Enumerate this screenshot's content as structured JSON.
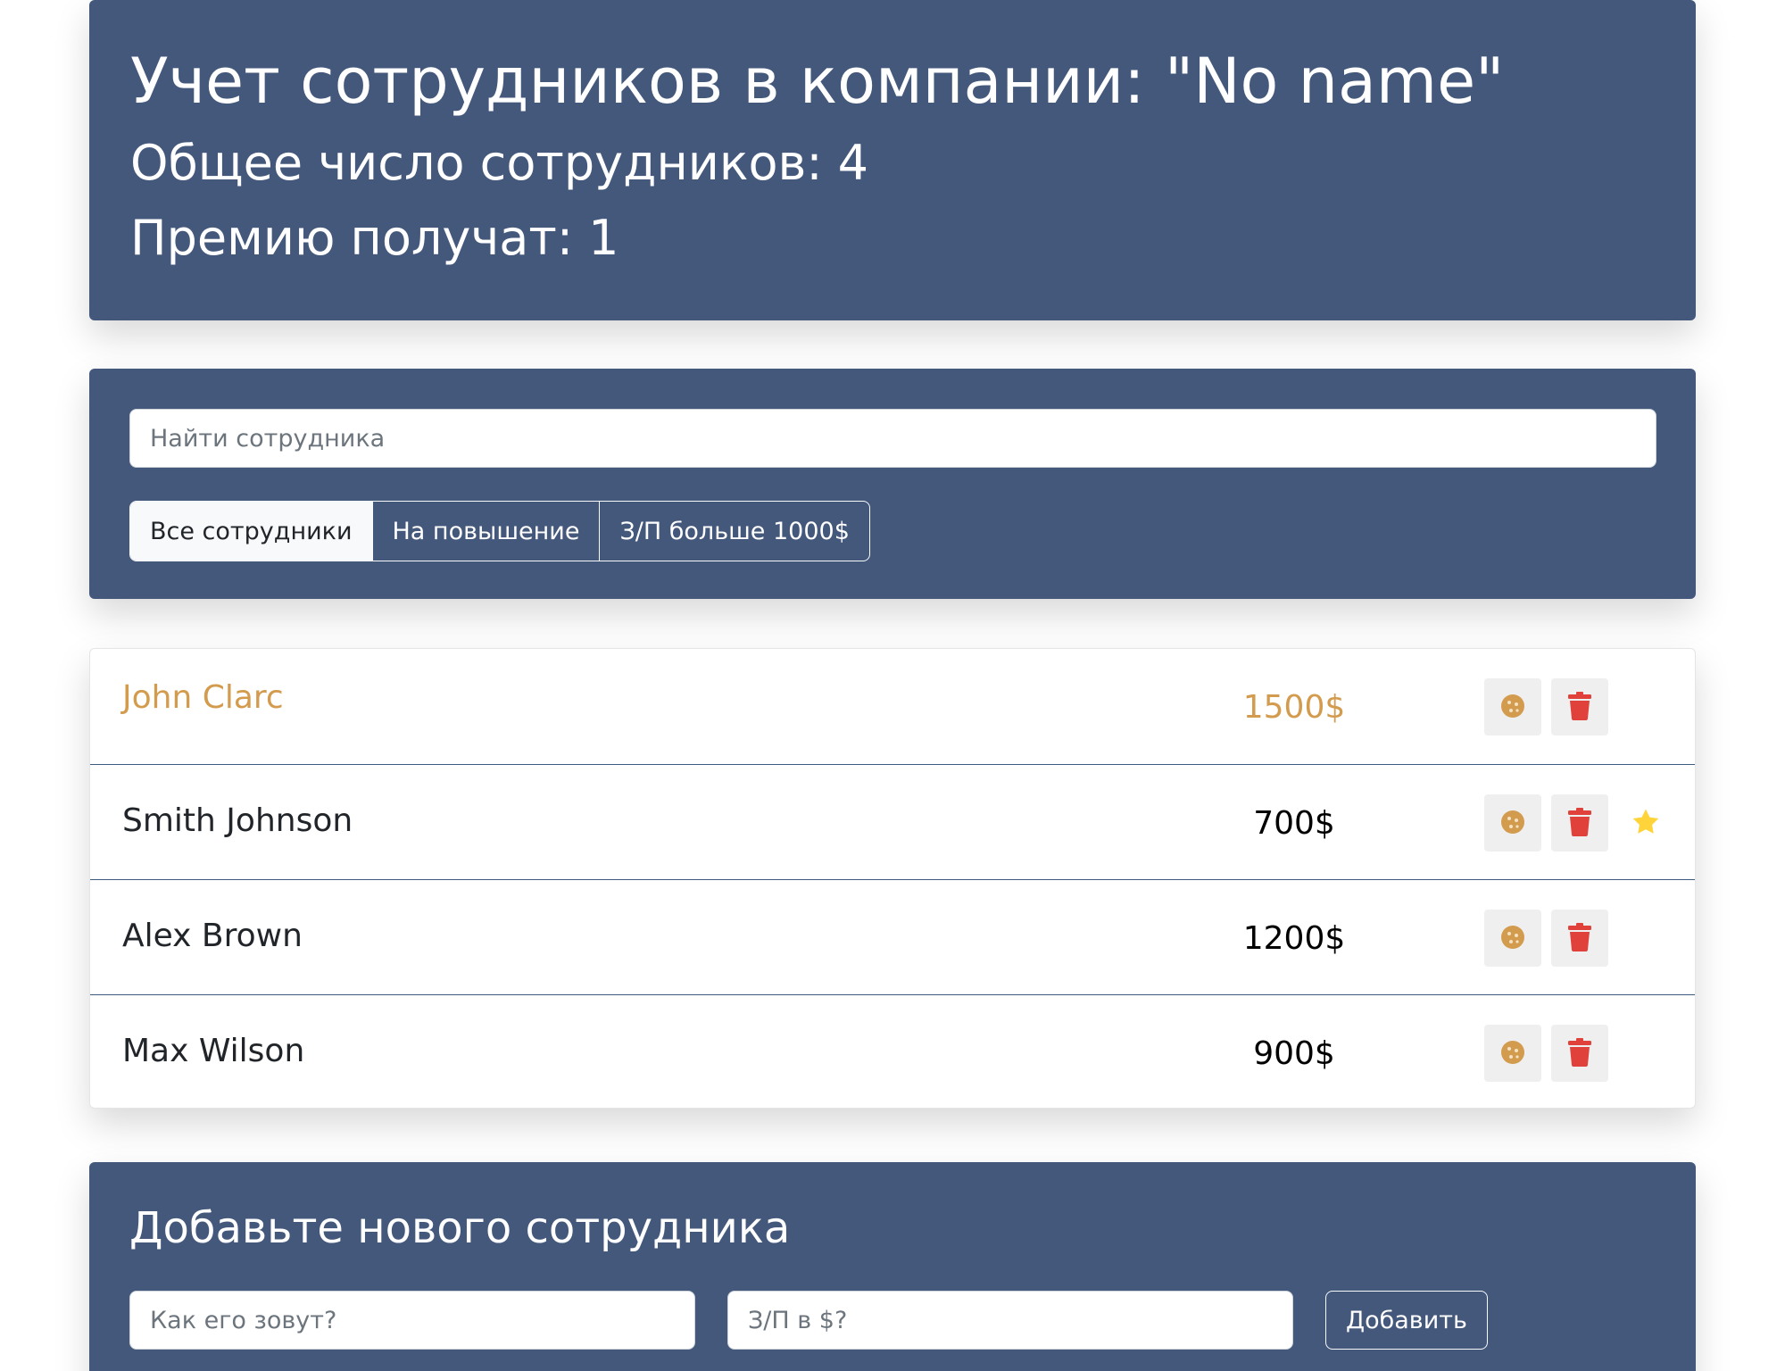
{
  "header": {
    "title": "Учет сотрудников в компании: \"No name\"",
    "total_label": "Общее число сотрудников: 4",
    "award_label": "Премию получат: 1"
  },
  "search": {
    "placeholder": "Найти сотрудника",
    "value": ""
  },
  "filters": [
    {
      "label": "Все сотрудники",
      "active": true
    },
    {
      "label": "На повышение",
      "active": false
    },
    {
      "label": "З/П больше 1000$",
      "active": false
    }
  ],
  "employees": [
    {
      "name": "John Clarc",
      "salary": "1500$",
      "increase": true,
      "rise": false
    },
    {
      "name": "Smith Johnson",
      "salary": "700$",
      "increase": false,
      "rise": true
    },
    {
      "name": "Alex Brown",
      "salary": "1200$",
      "increase": false,
      "rise": false
    },
    {
      "name": "Max Wilson",
      "salary": "900$",
      "increase": false,
      "rise": false
    }
  ],
  "icons": {
    "increase": "cookie-icon",
    "delete": "trash-icon",
    "rise": "star-icon"
  },
  "colors": {
    "panel": "#44587c",
    "increase_text": "#d39b4d",
    "trash": "#e0413a",
    "star": "#ffd43b"
  },
  "add_form": {
    "title": "Добавьте нового сотрудника",
    "name_placeholder": "Как его зовут?",
    "salary_placeholder": "З/П в $?",
    "submit_label": "Добавить"
  }
}
